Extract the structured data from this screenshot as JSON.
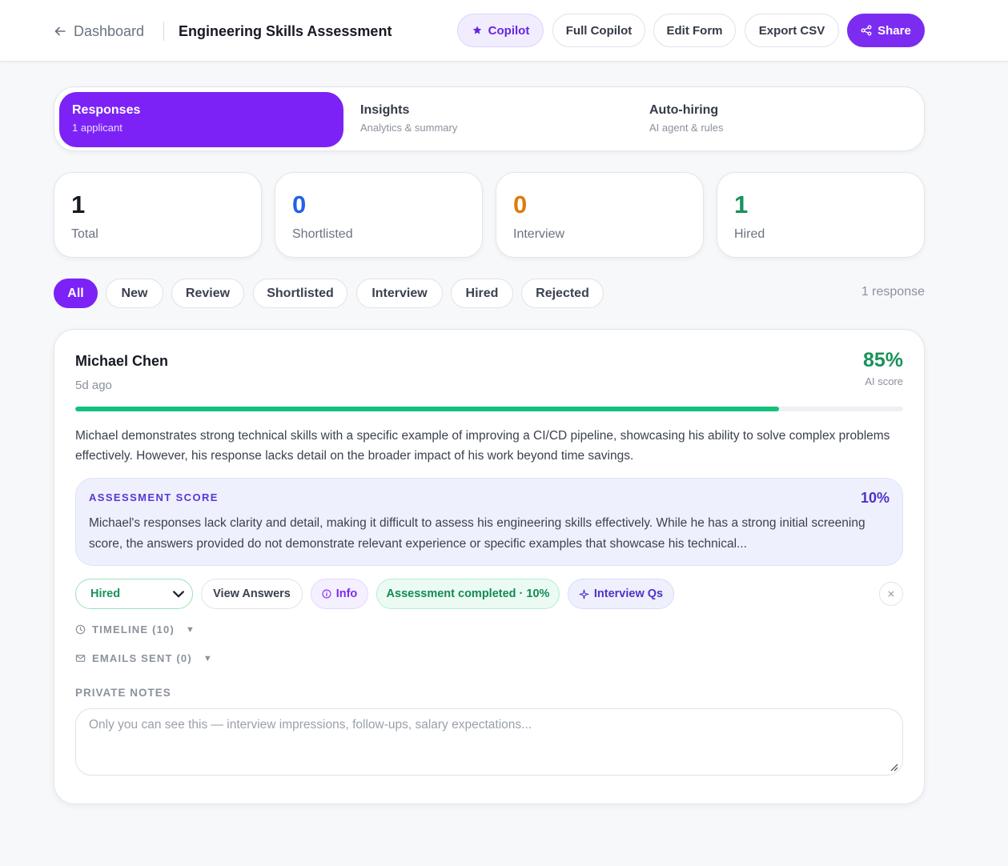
{
  "header": {
    "back_label": "Dashboard",
    "title": "Engineering Skills Assessment",
    "buttons": {
      "copilot": "Copilot",
      "full_copilot": "Full Copilot",
      "edit_form": "Edit Form",
      "export_csv": "Export CSV",
      "share": "Share"
    }
  },
  "tabs": [
    {
      "label": "Responses",
      "sub": "1 applicant"
    },
    {
      "label": "Insights",
      "sub": "Analytics & summary"
    },
    {
      "label": "Auto-hiring",
      "sub": "AI agent & rules"
    }
  ],
  "stats": [
    {
      "value": "1",
      "label": "Total",
      "color": "#161a23"
    },
    {
      "value": "0",
      "label": "Shortlisted",
      "color": "#2361e6"
    },
    {
      "value": "0",
      "label": "Interview",
      "color": "#dd7b0e"
    },
    {
      "value": "1",
      "label": "Hired",
      "color": "#18935a"
    }
  ],
  "filters": [
    "All",
    "New",
    "Review",
    "Shortlisted",
    "Interview",
    "Hired",
    "Rejected"
  ],
  "response_count": "1 response",
  "candidate": {
    "name": "Michael Chen",
    "time": "5d ago",
    "score": "85%",
    "score_fraction": 0.85,
    "score_label": "AI score",
    "summary": "Michael demonstrates strong technical skills with a specific example of improving a CI/CD pipeline, showcasing his ability to solve complex problems effectively. However, his response lacks detail on the broader impact of his work beyond time savings.",
    "assessment": {
      "heading": "ASSESSMENT SCORE",
      "value": "10%",
      "text": "Michael's responses lack clarity and detail, making it difficult to assess his engineering skills effectively. While he has a strong initial screening score, the answers provided do not demonstrate relevant experience or specific examples that showcase his technical..."
    },
    "actions": {
      "status": "Hired",
      "view_answers": "View Answers",
      "info": "Info",
      "assessment_done": "Assessment completed · 10%",
      "interview_qs": "Interview Qs"
    },
    "timeline_label": "TIMELINE (10)",
    "emails_label": "EMAILS SENT (0)",
    "notes_label": "PRIVATE NOTES",
    "notes_placeholder": "Only you can see this — interview impressions, follow-ups, salary expectations..."
  },
  "colors": {
    "accent": "#7c22f7",
    "success": "#18935a",
    "progress": "#14c07c"
  }
}
